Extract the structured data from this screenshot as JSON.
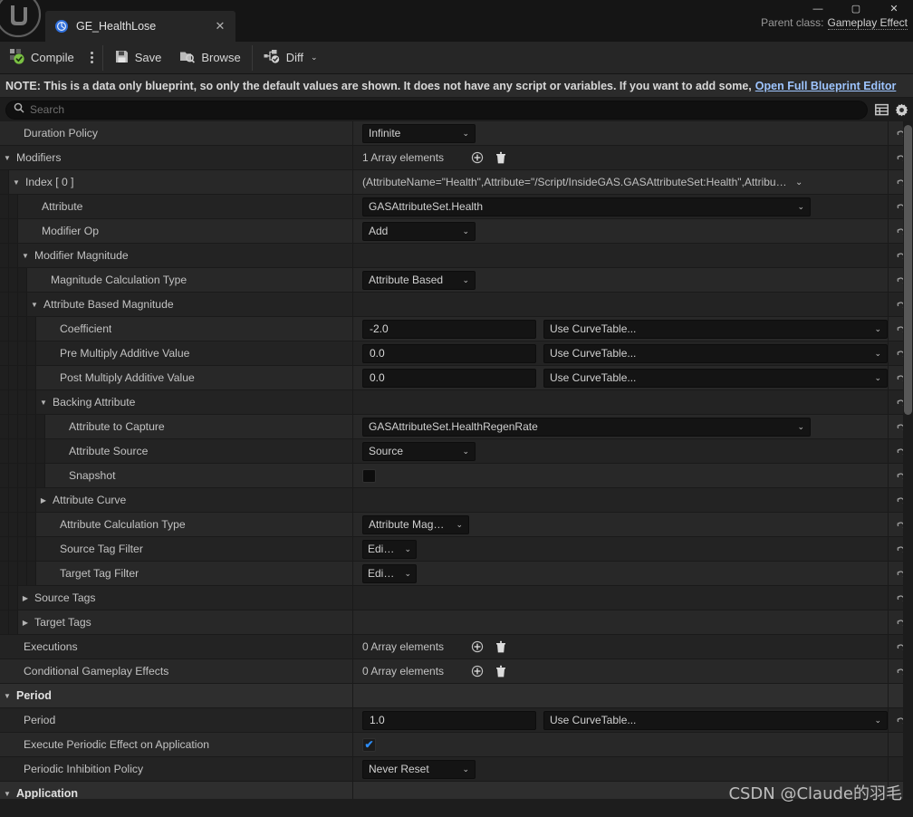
{
  "window": {
    "minimize_label": "—",
    "maximize_label": "▢",
    "close_label": "✕"
  },
  "tab": {
    "title": "GE_HealthLose",
    "close_label": "✕"
  },
  "header": {
    "parent_class_label": "Parent class:",
    "parent_class_value": "Gameplay Effect"
  },
  "toolbar": {
    "compile_label": "Compile",
    "save_label": "Save",
    "browse_label": "Browse",
    "diff_label": "Diff",
    "diff_caret": "⌄"
  },
  "note": {
    "text": "NOTE: This is a data only blueprint, so only the default values are shown.  It does not have any script or variables.  If you want to add some,",
    "link": "Open Full Blueprint Editor"
  },
  "search": {
    "placeholder": "Search",
    "value": "",
    "grid_icon": "table-view-icon",
    "settings_icon": "gear-icon"
  },
  "rows": [
    {
      "name": "Duration Policy",
      "indent": 0,
      "twisty": "none",
      "band": "A",
      "widget": "combo",
      "combo_width": "w125",
      "value": "Infinite",
      "reset": true
    },
    {
      "name": "Modifiers",
      "indent": 0,
      "twisty": "open",
      "band": "B",
      "widget": "array",
      "array_count": "1 Array elements",
      "reset": true
    },
    {
      "name": "Index [ 0 ]",
      "indent": 1,
      "twisty": "open",
      "band": "A",
      "widget": "indexcombo",
      "value": "(AttributeName=\"Health\",Attribute=\"/Script/InsideGAS.GASAttributeSet:Health\",AttributeOw",
      "reset": true
    },
    {
      "name": "Attribute",
      "indent": 2,
      "twisty": "none",
      "band": "B",
      "widget": "combo",
      "combo_width": "w495",
      "value": "GASAttributeSet.Health",
      "reset": true
    },
    {
      "name": "Modifier Op",
      "indent": 2,
      "twisty": "none",
      "band": "A",
      "widget": "combo",
      "combo_width": "w125",
      "value": "Add",
      "reset": true
    },
    {
      "name": "Modifier Magnitude",
      "indent": 2,
      "twisty": "open",
      "band": "B",
      "widget": "none",
      "reset": true
    },
    {
      "name": "Magnitude Calculation Type",
      "indent": 3,
      "twisty": "none",
      "band": "A",
      "widget": "combo",
      "combo_width": "w125",
      "value": "Attribute Based",
      "reset": true
    },
    {
      "name": "Attribute Based Magnitude",
      "indent": 3,
      "twisty": "open",
      "band": "B",
      "widget": "none",
      "reset": true
    },
    {
      "name": "Coefficient",
      "indent": 4,
      "twisty": "none",
      "band": "A",
      "widget": "num_curve",
      "value": "-2.0",
      "curve": "Use CurveTable...",
      "reset": true
    },
    {
      "name": "Pre Multiply Additive Value",
      "indent": 4,
      "twisty": "none",
      "band": "B",
      "widget": "num_curve",
      "value": "0.0",
      "curve": "Use CurveTable...",
      "reset": true
    },
    {
      "name": "Post Multiply Additive Value",
      "indent": 4,
      "twisty": "none",
      "band": "A",
      "widget": "num_curve",
      "value": "0.0",
      "curve": "Use CurveTable...",
      "reset": true
    },
    {
      "name": "Backing Attribute",
      "indent": 4,
      "twisty": "open",
      "band": "B",
      "widget": "none",
      "reset": true
    },
    {
      "name": "Attribute to Capture",
      "indent": 5,
      "twisty": "none",
      "band": "A",
      "widget": "combo",
      "combo_width": "w495",
      "value": "GASAttributeSet.HealthRegenRate",
      "reset": true
    },
    {
      "name": "Attribute Source",
      "indent": 5,
      "twisty": "none",
      "band": "B",
      "widget": "combo",
      "combo_width": "w125",
      "value": "Source",
      "reset": true
    },
    {
      "name": "Snapshot",
      "indent": 5,
      "twisty": "none",
      "band": "A",
      "widget": "checkbox",
      "checked": false,
      "reset": true
    },
    {
      "name": "Attribute Curve",
      "indent": 4,
      "twisty": "closed",
      "band": "B",
      "widget": "none",
      "reset": true
    },
    {
      "name": "Attribute Calculation Type",
      "indent": 4,
      "twisty": "none",
      "band": "A",
      "widget": "combo",
      "combo_width": "w118",
      "value": "Attribute Magnitude",
      "reset": true
    },
    {
      "name": "Source Tag Filter",
      "indent": 4,
      "twisty": "none",
      "band": "B",
      "widget": "combo",
      "combo_width": "w60",
      "value": "Edit...",
      "reset": true
    },
    {
      "name": "Target Tag Filter",
      "indent": 4,
      "twisty": "none",
      "band": "A",
      "widget": "combo",
      "combo_width": "w60",
      "value": "Edit...",
      "reset": true
    },
    {
      "name": "Source Tags",
      "indent": 2,
      "twisty": "closed",
      "band": "B",
      "widget": "none",
      "reset": true
    },
    {
      "name": "Target Tags",
      "indent": 2,
      "twisty": "closed",
      "band": "A",
      "widget": "none",
      "reset": true
    },
    {
      "name": "Executions",
      "indent": 0,
      "twisty": "none",
      "band": "B",
      "widget": "array",
      "array_count": "0 Array elements",
      "reset": true
    },
    {
      "name": "Conditional Gameplay Effects",
      "indent": 0,
      "twisty": "none",
      "band": "A",
      "widget": "array",
      "array_count": "0 Array elements",
      "reset": true
    },
    {
      "name": "Period",
      "indent": 0,
      "twisty": "open",
      "band": "SECTION",
      "widget": "none",
      "reset": false
    },
    {
      "name": "Period",
      "indent": 0,
      "twisty": "none",
      "band": "B",
      "widget": "num_curve",
      "value": "1.0",
      "curve": "Use CurveTable...",
      "reset": true
    },
    {
      "name": "Execute Periodic Effect on Application",
      "indent": 0,
      "twisty": "none",
      "band": "A",
      "widget": "checkbox",
      "checked": true,
      "reset": false
    },
    {
      "name": "Periodic Inhibition Policy",
      "indent": 0,
      "twisty": "none",
      "band": "B",
      "widget": "combo",
      "combo_width": "w125",
      "value": "Never Reset",
      "reset": false
    },
    {
      "name": "Application",
      "indent": 0,
      "twisty": "open",
      "band": "SECTION",
      "widget": "none",
      "reset": false
    }
  ],
  "watermark": "CSDN @Claude的羽毛",
  "colors": {
    "accent_blue": "#2d8cf5",
    "link_blue": "#9ec5ff",
    "row_a": "#282828",
    "row_b": "#232323",
    "section": "#2e2e2e",
    "compile_green": "#7ac043"
  }
}
